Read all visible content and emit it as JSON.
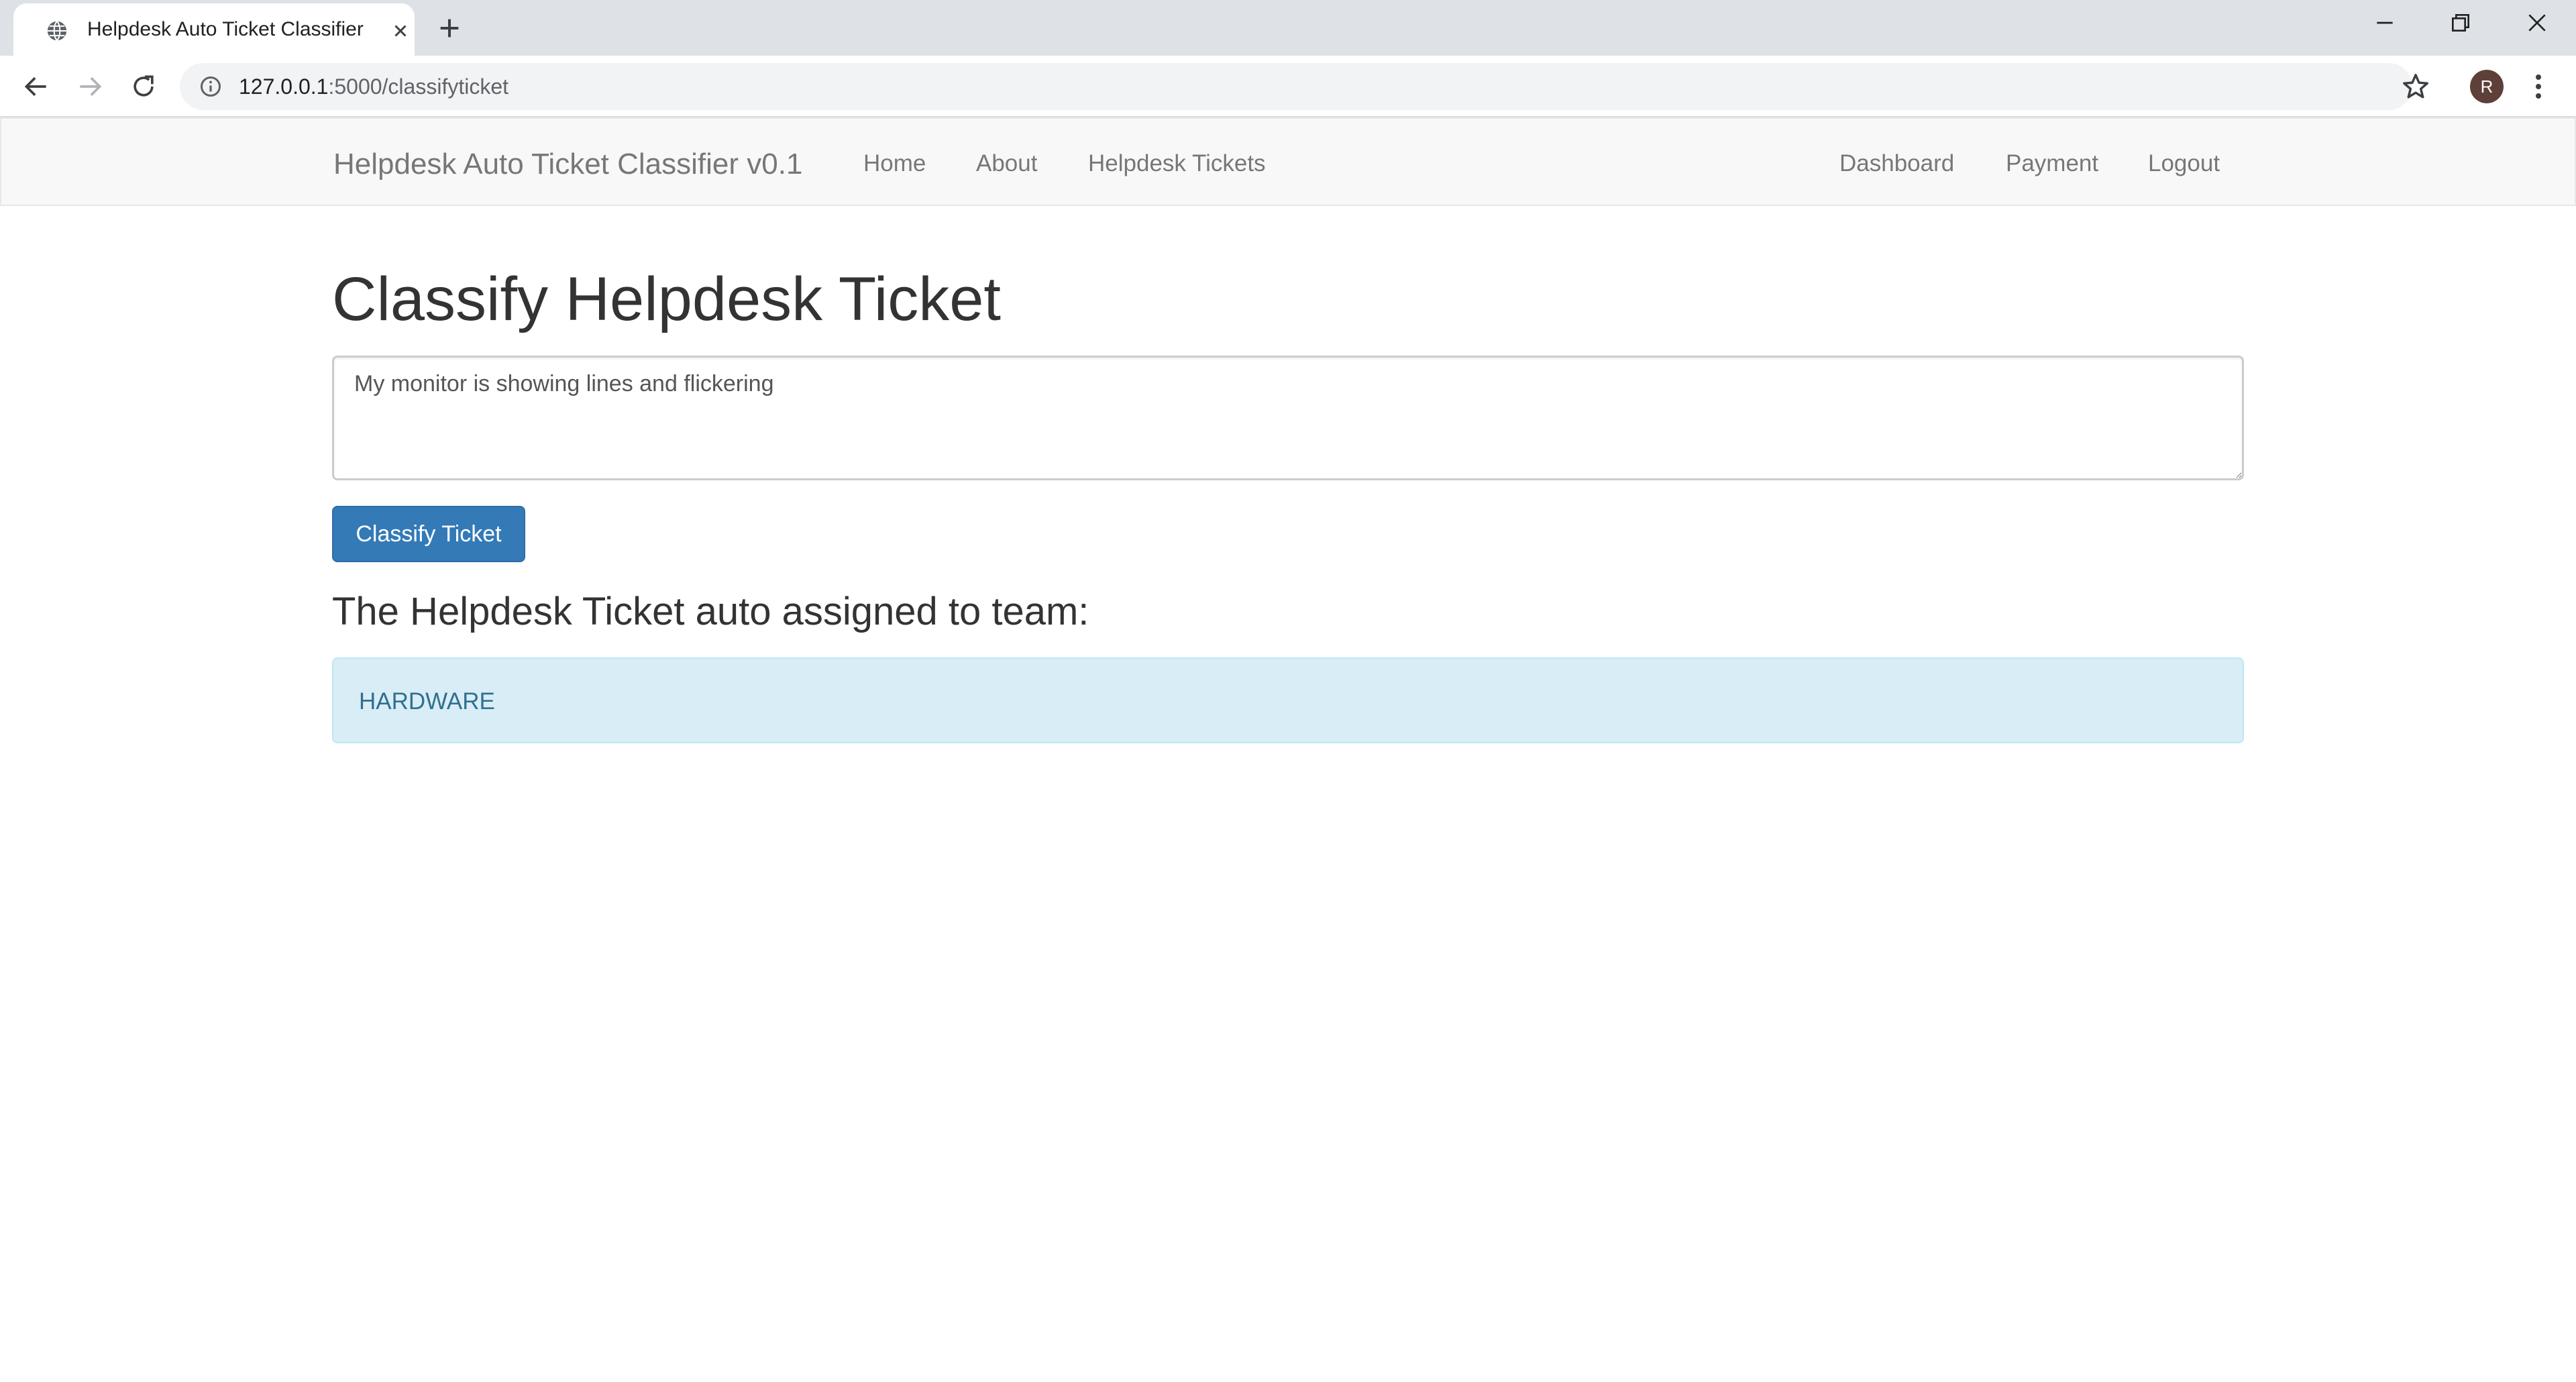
{
  "browser": {
    "tab_title": "Helpdesk Auto Ticket Classifier",
    "url_host": "127.0.0.1",
    "url_path": ":5000/classifyticket",
    "profile_initial": "R"
  },
  "navbar": {
    "brand": "Helpdesk Auto Ticket Classifier v0.1",
    "left_links": [
      "Home",
      "About",
      "Helpdesk Tickets"
    ],
    "right_links": [
      "Dashboard",
      "Payment",
      "Logout"
    ]
  },
  "main": {
    "title": "Classify Helpdesk Ticket",
    "ticket_text": "My monitor is showing lines and flickering",
    "classify_button": "Classify Ticket",
    "result_heading": "The Helpdesk Ticket auto assigned to team:",
    "result_team": "HARDWARE"
  },
  "colors": {
    "primary_button": "#337ab7",
    "alert_background": "#d9edf7",
    "alert_text": "#31708f",
    "navbar_background": "#f8f8f8"
  }
}
